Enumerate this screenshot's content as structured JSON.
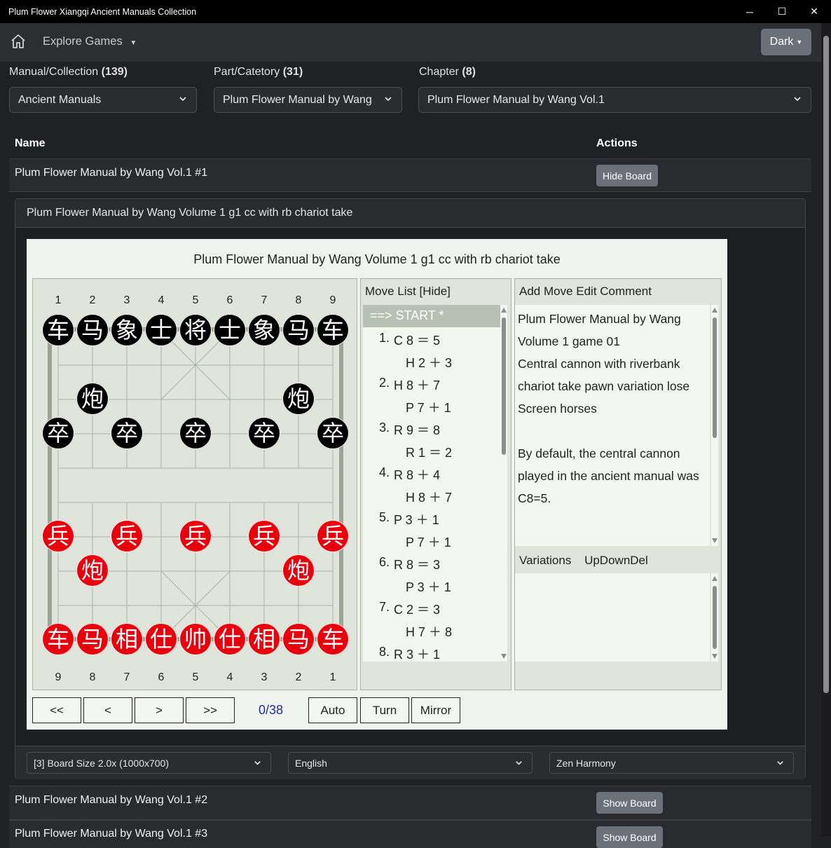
{
  "window": {
    "title": "Plum Flower Xiangqi Ancient Manuals Collection",
    "minimize": "─",
    "maximize": "☐",
    "close": "✕"
  },
  "navbar": {
    "home_icon": "home-icon",
    "explore": "Explore Games",
    "theme_button": "Dark"
  },
  "filters": [
    {
      "label": "Manual/Collection",
      "count": "(139)",
      "value": "Ancient Manuals"
    },
    {
      "label": "Part/Catetory",
      "count": "(31)",
      "value": "Plum Flower Manual by Wang"
    },
    {
      "label": "Chapter",
      "count": "(8)",
      "value": "Plum Flower Manual by Wang Vol.1"
    }
  ],
  "table": {
    "headers": {
      "name": "Name",
      "actions": "Actions"
    },
    "rows": [
      {
        "name": "Plum Flower Manual by Wang Vol.1 #1",
        "action": "Hide Board"
      },
      {
        "name": "Plum Flower Manual by Wang Vol.1 #2",
        "action": "Show Board"
      },
      {
        "name": "Plum Flower Manual by Wang Vol.1 #3",
        "action": "Show Board"
      }
    ]
  },
  "card": {
    "header": "Plum Flower Manual by Wang Volume 1 g1 cc with rb chariot take",
    "board_title": "Plum Flower Manual by Wang Volume 1 g1 cc with rb chariot take",
    "top_numbers": [
      "1",
      "2",
      "3",
      "4",
      "5",
      "6",
      "7",
      "8",
      "9"
    ],
    "bottom_numbers": [
      "9",
      "8",
      "7",
      "6",
      "5",
      "4",
      "3",
      "2",
      "1"
    ],
    "pieces": {
      "black_chariot": "车",
      "black_horse": "马",
      "black_elephant": "象",
      "black_advisor": "士",
      "black_general": "将",
      "black_cannon": "炮",
      "black_soldier": "卒",
      "red_chariot": "车",
      "red_horse": "马",
      "red_elephant": "相",
      "red_advisor": "仕",
      "red_general": "帅",
      "red_cannon": "炮",
      "red_soldier": "兵"
    },
    "move_list": {
      "header": "Move List [Hide]",
      "moves": [
        {
          "n": "",
          "m": "==> START *"
        },
        {
          "n": "1.",
          "m": "C 8 ＝ 5"
        },
        {
          "n": "",
          "m": "H 2 ＋ 3"
        },
        {
          "n": "2.",
          "m": "H 8 ＋ 7"
        },
        {
          "n": "",
          "m": "P 7 ＋ 1"
        },
        {
          "n": "3.",
          "m": "R 9 ＝ 8"
        },
        {
          "n": "",
          "m": "R 1 ＝ 2"
        },
        {
          "n": "4.",
          "m": "R 8 ＋ 4"
        },
        {
          "n": "",
          "m": "H 8 ＋ 7"
        },
        {
          "n": "5.",
          "m": "P 3 ＋ 1"
        },
        {
          "n": "",
          "m": "P 7 ＋ 1"
        },
        {
          "n": "6.",
          "m": "R 8 ＝ 3"
        },
        {
          "n": "",
          "m": "P 3 ＋ 1"
        },
        {
          "n": "7.",
          "m": "C 2 ＝ 3"
        },
        {
          "n": "",
          "m": "H 7 ＋ 8"
        },
        {
          "n": "8.",
          "m": "R 3 ＋ 1"
        }
      ]
    },
    "comment": {
      "header": "Add Move Edit Comment",
      "text": "Plum Flower Manual by Wang\nVolume 1 game 01\nCentral cannon with riverbank\nchariot take pawn variation lose\nScreen horses\n\nBy default, the central cannon\nplayed in the ancient manual was\nC8=5.",
      "variations_label": "Variations",
      "variation_controls": "UpDownDel"
    },
    "nav": {
      "first": "<<",
      "prev": "<",
      "next": ">",
      "last": ">>",
      "counter": "0/38",
      "auto": "Auto",
      "turn": "Turn",
      "mirror": "Mirror"
    },
    "footer": {
      "board_size": "[3] Board Size 2.0x (1000x700)",
      "language": "English",
      "theme": "Zen Harmony"
    }
  }
}
